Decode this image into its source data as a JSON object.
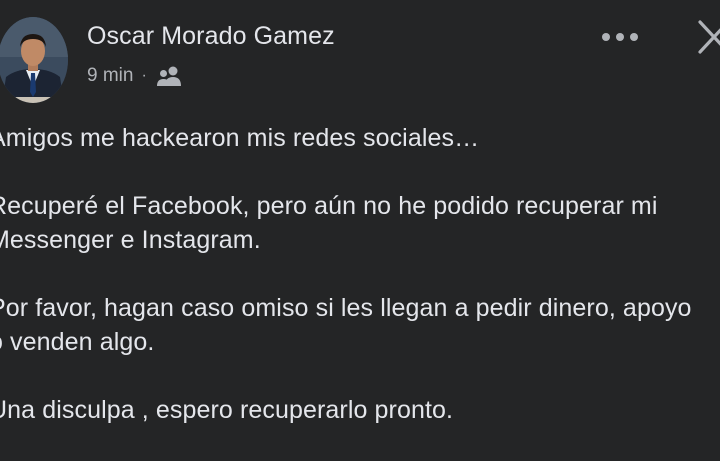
{
  "post": {
    "author_name": "Oscar Morado Gamez",
    "timestamp": "9 min",
    "separator": "·",
    "audience_icon": "friends-icon",
    "paragraphs": [
      "Amigos me hackearon mis redes sociales…",
      "Recuperé el Facebook, pero aún no he podido recuperar mi",
      "Messenger e Instagram.",
      "Por favor, hagan caso omiso si les llegan a pedir dinero, apoyo",
      "o venden algo.",
      "Una disculpa , espero recuperarlo pronto."
    ]
  },
  "colors": {
    "background": "#242526",
    "primary_text": "#e4e6eb",
    "secondary_text": "#b0b3b8"
  }
}
